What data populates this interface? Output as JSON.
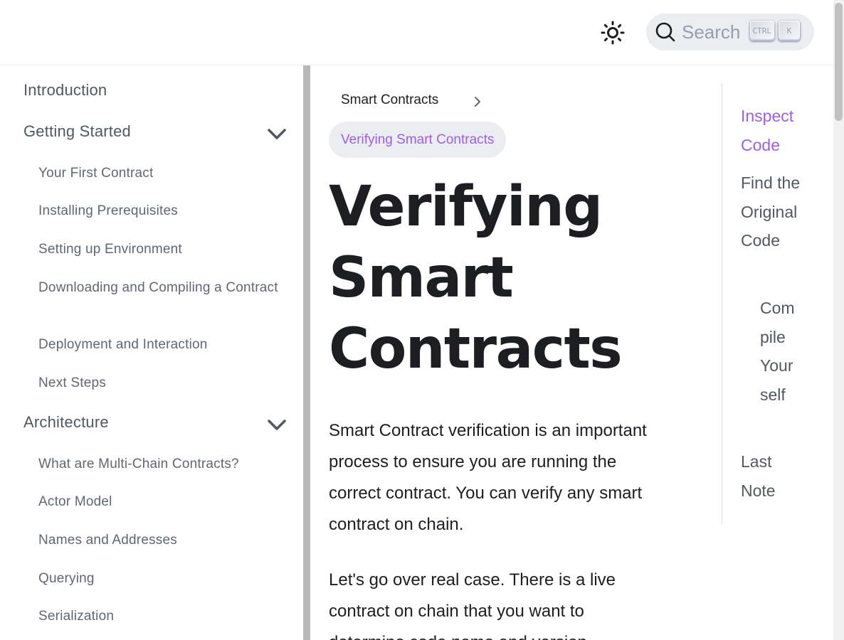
{
  "navbar": {
    "theme_toggle_icon": "sun-icon",
    "search": {
      "label": "Search",
      "keys": [
        "CTRL",
        "K"
      ]
    }
  },
  "sidebar": {
    "sections": [
      {
        "label": "Introduction"
      },
      {
        "label": "Getting Started",
        "expanded": true,
        "items": [
          "Your First Contract",
          "Installing Prerequisites",
          "Setting up Environment",
          "Downloading and Compiling a Contract",
          "Deployment and Interaction",
          "Next Steps"
        ]
      },
      {
        "label": "Architecture",
        "expanded": true,
        "items": [
          "What are Multi-Chain Contracts?",
          "Actor Model",
          "Names and Addresses",
          "Querying",
          "Serialization"
        ]
      }
    ]
  },
  "breadcrumb": {
    "parent": "Smart Contracts",
    "current": "Verifying Smart Contracts"
  },
  "main": {
    "title": "Verifying Smart Contracts",
    "paragraphs": [
      "Smart Contract verification is an important process to ensure you are running the correct contract. You can verify any smart contract on chain.",
      "Let's go over real case. There is a live contract on chain that you want to determine code name and version."
    ]
  },
  "toc": {
    "items": [
      {
        "label": "Inspect Code",
        "active": true
      },
      {
        "label": "Find the Original Code"
      },
      {
        "label": "Compile Yourself"
      },
      {
        "label": "Last Note"
      }
    ]
  },
  "colors": {
    "accent": "#9c5fe6",
    "text": "#1c1e21",
    "muted": "#606770",
    "chip_bg": "#ebedf0"
  }
}
